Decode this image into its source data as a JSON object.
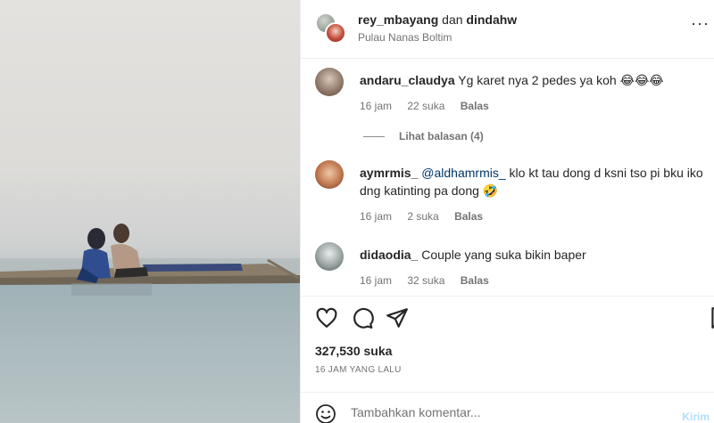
{
  "post": {
    "owner1": "rey_mbayang",
    "conjunction": "dan",
    "owner2": "dindahw",
    "location": "Pulau Nanas Boltim",
    "more_icon": "more-icon"
  },
  "comments": [
    {
      "user": "andaru_claudya",
      "text": "Yg karet nya 2 pedes ya koh 😂😂😂",
      "age": "16 jam",
      "likes": "22 suka",
      "reply": "Balas",
      "view_replies": "Lihat balasan (4)"
    },
    {
      "user": "aymrmis_",
      "mention": "@aldhamrmis_",
      "text": " klo kt tau dong d ksni tso pi bku iko dng katinting pa dong 🤣",
      "age": "16 jam",
      "likes": "2 suka",
      "reply": "Balas"
    },
    {
      "user": "didaodia_",
      "text": "Couple yang suka bikin baper",
      "age": "16 jam",
      "likes": "32 suka",
      "reply": "Balas"
    }
  ],
  "stats": {
    "likes": "327,530 suka",
    "time": "16 JAM YANG LALU"
  },
  "comment_bar": {
    "placeholder": "Tambahkan komentar...",
    "post_label": "Kirim"
  },
  "colors": {
    "mention": "#00376b",
    "muted": "#737373",
    "post_disabled": "#b2dffc"
  }
}
